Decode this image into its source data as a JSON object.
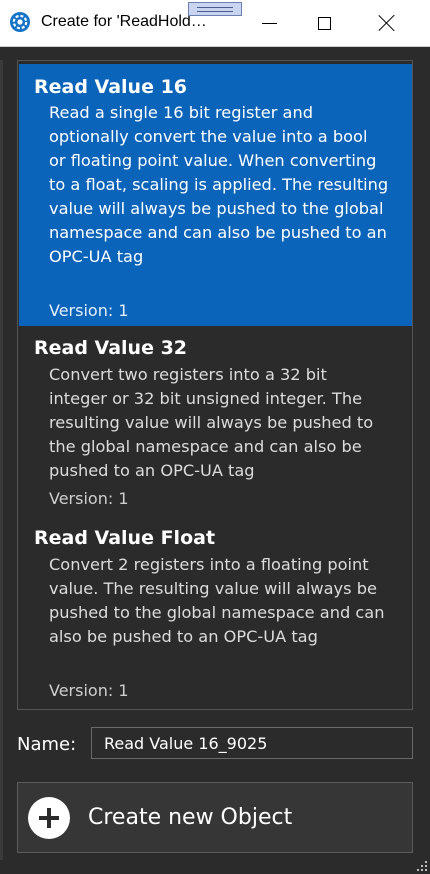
{
  "window": {
    "title": "Create for 'ReadHold…",
    "minimize_icon": "minimize-icon",
    "maximize_icon": "maximize-icon",
    "close_icon": "close-icon"
  },
  "items": [
    {
      "title": "Read Value 16",
      "description": "Read a single 16 bit register and optionally convert the value into a bool or floating point value. When converting to a float, scaling is applied. The resulting value will always be pushed to the global namespace and can also be pushed to an OPC-UA tag",
      "version": "Version: 1",
      "selected": true
    },
    {
      "title": "Read Value 32",
      "description": "Convert two registers into a 32 bit integer or 32 bit unsigned integer. The resulting value will always be pushed to the global namespace and can also be pushed to an OPC-UA tag",
      "version": "Version: 1",
      "selected": false
    },
    {
      "title": "Read Value Float",
      "description": "Convert 2 registers into a floating point value. The resulting value will always be pushed to the global namespace and can also be pushed to an OPC-UA tag",
      "version": "Version: 1",
      "selected": false
    }
  ],
  "name_field": {
    "label": "Name:",
    "value": "Read Value 16_9025"
  },
  "create_button": {
    "label": "Create new Object",
    "icon": "plus-circle-icon"
  },
  "colors": {
    "selection": "#0a64b9",
    "background": "#2b2b2b"
  }
}
